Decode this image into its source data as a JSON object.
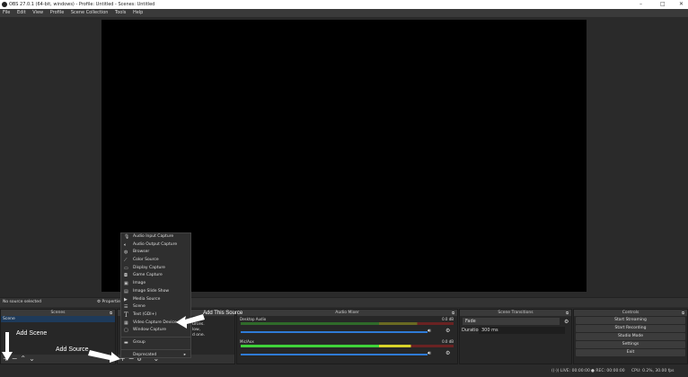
{
  "window": {
    "title": "OBS 27.0.1 (64-bit, windows) - Profile: Untitled - Scenes: Untitled",
    "minimize": "–",
    "maximize": "□",
    "close": "✕"
  },
  "menubar": [
    "File",
    "Edit",
    "View",
    "Profile",
    "Scene Collection",
    "Tools",
    "Help"
  ],
  "source_bar": {
    "status": "No source selected",
    "properties": "Properties"
  },
  "scenes": {
    "title": "Scenes",
    "items": [
      "Scene"
    ]
  },
  "sources": {
    "hint_lines": [
      "urces.",
      "low,",
      "d one."
    ]
  },
  "context_menu": {
    "items": [
      {
        "icon": "microphone-icon",
        "label": "Audio Input Capture"
      },
      {
        "icon": "speaker-icon",
        "label": "Audio Output Capture"
      },
      {
        "icon": "globe-icon",
        "label": "Browser"
      },
      {
        "icon": "brush-icon",
        "label": "Color Source"
      },
      {
        "icon": "monitor-icon",
        "label": "Display Capture"
      },
      {
        "icon": "gamepad-icon",
        "label": "Game Capture"
      },
      {
        "icon": "image-icon",
        "label": "Image"
      },
      {
        "icon": "slideshow-icon",
        "label": "Image Slide Show"
      },
      {
        "icon": "play-icon",
        "label": "Media Source"
      },
      {
        "icon": "list-icon",
        "label": "Scene"
      },
      {
        "icon": "text-icon",
        "label": "Text (GDI+)"
      },
      {
        "icon": "camera-icon",
        "label": "Video Capture Device"
      },
      {
        "icon": "window-icon",
        "label": "Window Capture"
      }
    ],
    "group": "Group",
    "deprecated": "Deprecated"
  },
  "audio_mixer": {
    "title": "Audio Mixer",
    "channels": [
      {
        "name": "Desktop Audio",
        "level": "0.0 dB",
        "volume": 1.0
      },
      {
        "name": "Mic/Aux",
        "level": "0.0 dB",
        "volume": 1.0
      }
    ]
  },
  "transitions": {
    "title": "Scene Transitions",
    "selected": "Fade",
    "duration_label": "Duration",
    "duration": "300 ms"
  },
  "controls": {
    "title": "Controls",
    "buttons": [
      "Start Streaming",
      "Start Recording",
      "Studio Mode",
      "Settings",
      "Exit"
    ]
  },
  "status": {
    "live": "LIVE: 00:00:00",
    "rec": "REC: 00:00:00",
    "cpu": "CPU: 0.2%, 30.00 fps"
  },
  "annotations": {
    "add_scene": "Add Scene",
    "add_source": "Add Source",
    "add_this_source": "Add This Source"
  }
}
